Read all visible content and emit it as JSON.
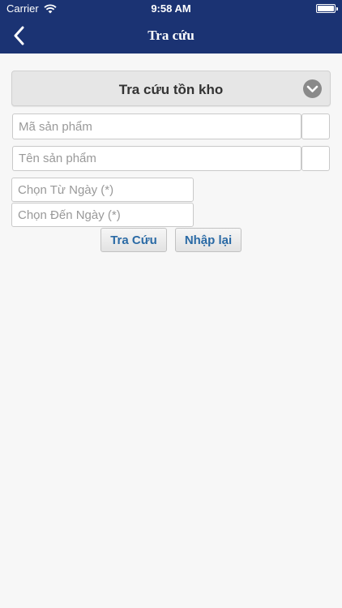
{
  "status_bar": {
    "carrier": "Carrier",
    "time": "9:58 AM"
  },
  "nav": {
    "title": "Tra cứu"
  },
  "section": {
    "title": "Tra cứu tồn kho"
  },
  "form": {
    "product_code_placeholder": "Mã sản phẩm",
    "product_name_placeholder": "Tên sản phẩm",
    "from_date_placeholder": "Chọn Từ Ngày (*)",
    "to_date_placeholder": "Chọn Đến Ngày (*)"
  },
  "buttons": {
    "search_label": "Tra Cứu",
    "reset_label": "Nhập lại"
  },
  "colors": {
    "nav_bg": "#1b3373",
    "button_text": "#2a6aa5",
    "background": "#f7f7f7"
  }
}
